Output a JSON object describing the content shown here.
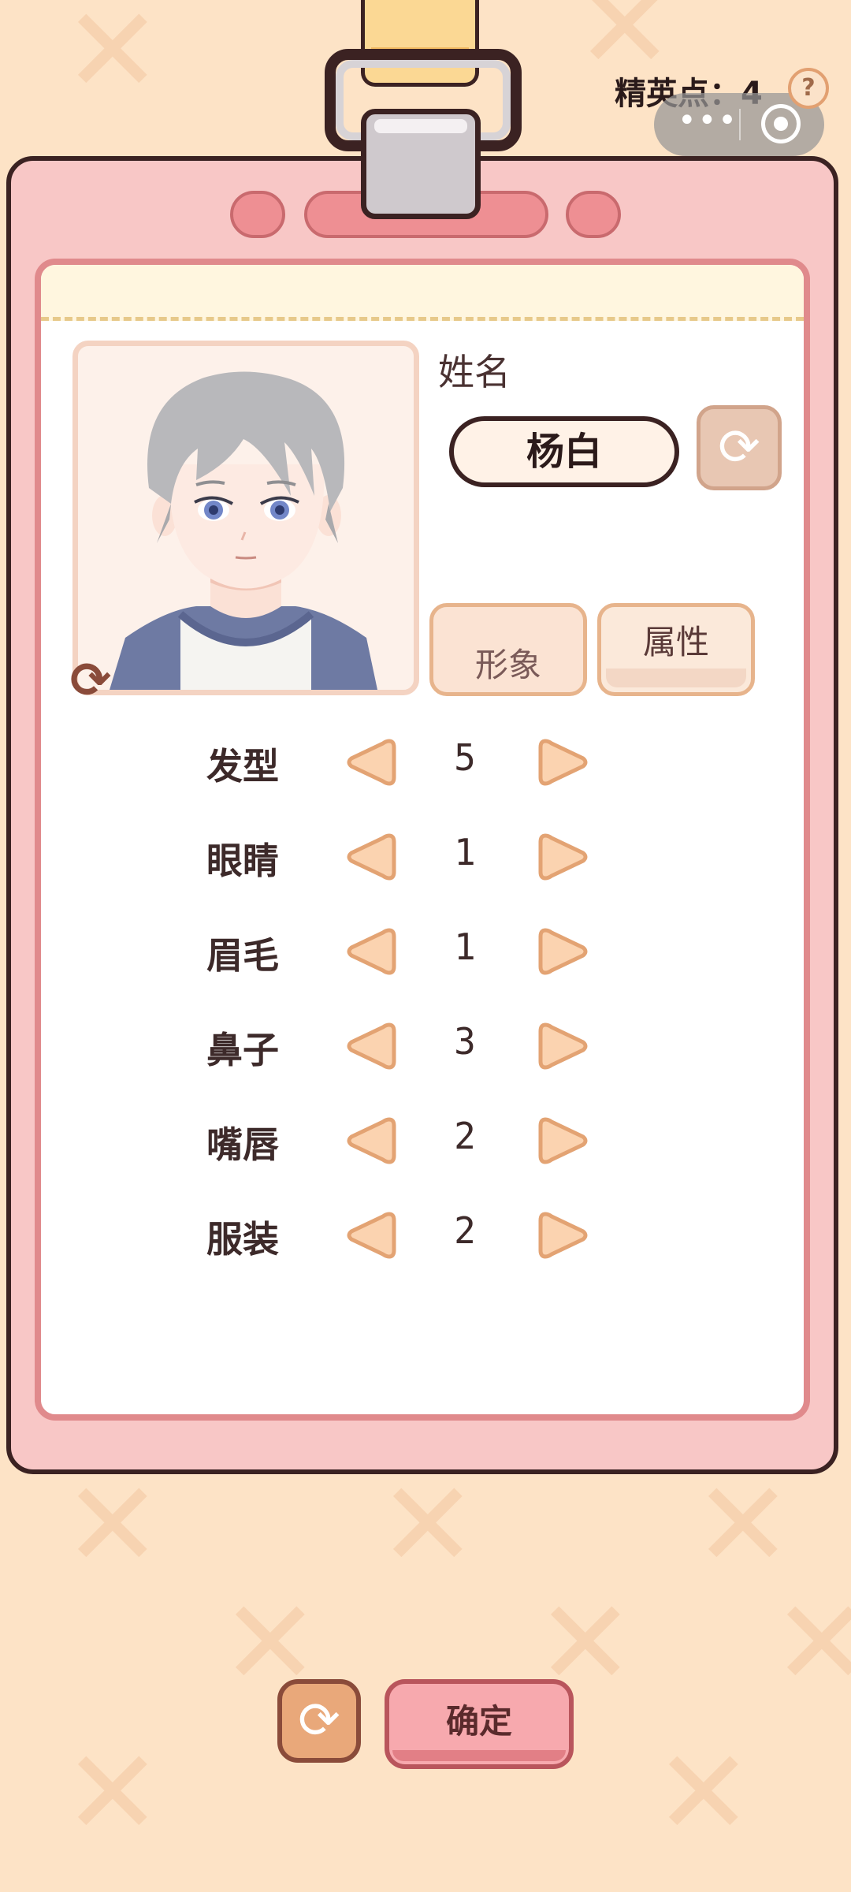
{
  "header": {
    "elite_points_label": "精英点：",
    "elite_points_value": "4",
    "help_label": "?",
    "capsule_more": "•••"
  },
  "profile": {
    "name_label": "姓名",
    "name_value": "杨白"
  },
  "tabs": [
    {
      "label": "形象",
      "selected": true
    },
    {
      "label": "属性",
      "selected": false
    }
  ],
  "features": [
    {
      "label": "发型",
      "value": "5"
    },
    {
      "label": "眼睛",
      "value": "1"
    },
    {
      "label": "眉毛",
      "value": "1"
    },
    {
      "label": "鼻子",
      "value": "3"
    },
    {
      "label": "嘴唇",
      "value": "2"
    },
    {
      "label": "服装",
      "value": "2"
    }
  ],
  "footer": {
    "confirm_label": "确定"
  },
  "icons": {
    "refresh": "refresh-icon",
    "arrow_left": "arrow-left-icon",
    "arrow_right": "arrow-right-icon"
  },
  "colors": {
    "background": "#fde3c6",
    "card": "#f8c7c6",
    "outline": "#3b2222",
    "arrow_fill": "#fbd3b0",
    "arrow_stroke": "#e3a373",
    "confirm": "#f7a9ae"
  }
}
